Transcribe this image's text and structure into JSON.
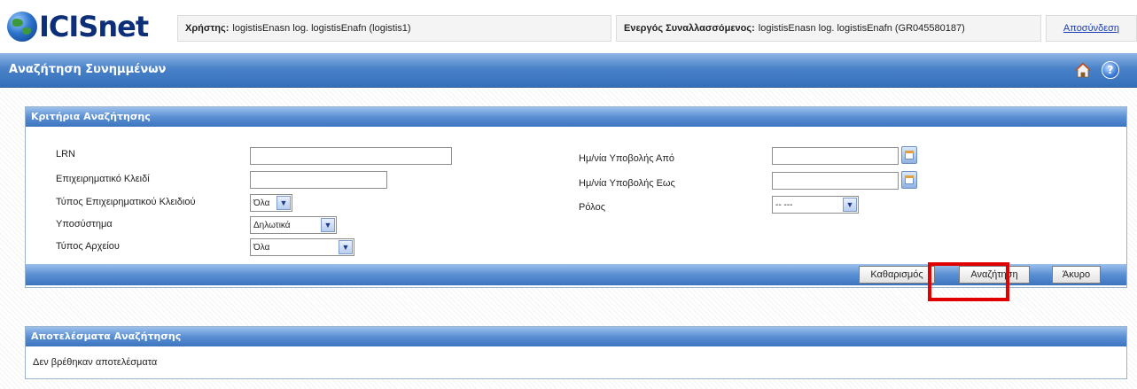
{
  "header": {
    "logo_text": "ICISnet",
    "user_label": "Χρήστης:",
    "user_value": "logistisEnasn log. logistisEnafn (logistis1)",
    "trader_label": "Ενεργός Συναλλασσόμενος:",
    "trader_value": "logistisEnasn log. logistisEnafn (GR045580187)",
    "logout_label": "Αποσύνδεση"
  },
  "page": {
    "title": "Αναζήτηση Συνημμένων",
    "help_glyph": "?"
  },
  "criteria": {
    "title": "Κριτήρια Αναζήτησης",
    "fields": {
      "lrn": {
        "label": "LRN",
        "value": ""
      },
      "business_key": {
        "label": "Επιχειρηματικό Κλειδί",
        "value": ""
      },
      "business_key_type": {
        "label": "Τύπος Επιχειρηματικού Κλειδιού",
        "selected": "Όλα"
      },
      "subsystem": {
        "label": "Υποσύστημα",
        "selected": "Δηλωτικά"
      },
      "file_type": {
        "label": "Τύπος Αρχείου",
        "selected": "Όλα"
      },
      "date_from": {
        "label": "Ημ/νία Υποβολής Από",
        "value": ""
      },
      "date_to": {
        "label": "Ημ/νία Υποβολής Εως",
        "value": ""
      },
      "role": {
        "label": "Ρόλος",
        "selected": "-- ---"
      }
    },
    "buttons": {
      "clear": "Καθαρισμός",
      "search": "Αναζήτηση",
      "cancel": "Άκυρο"
    }
  },
  "results": {
    "title": "Αποτελέσματα Αναζήτησης",
    "message": "Δεν βρέθηκαν αποτελέσματα"
  },
  "colors": {
    "bar_blue": "#3c74bf",
    "logo_navy": "#0d2f7a",
    "highlight_red": "#e00000",
    "link_blue": "#1a3bb5"
  }
}
